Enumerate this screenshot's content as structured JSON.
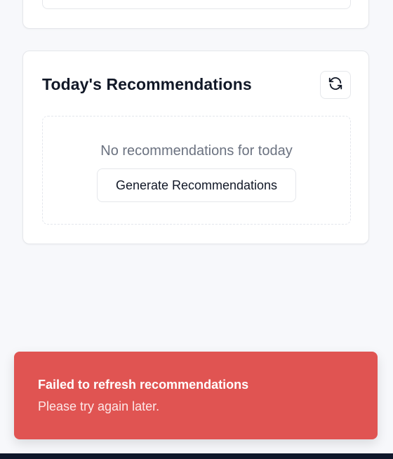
{
  "recommendations": {
    "title": "Today's Recommendations",
    "empty_message": "No recommendations for today",
    "generate_label": "Generate Recommendations",
    "refresh_icon": "refresh-icon"
  },
  "toast": {
    "title": "Failed to refresh recommendations",
    "description": "Please try again later.",
    "color": "#e05452"
  }
}
